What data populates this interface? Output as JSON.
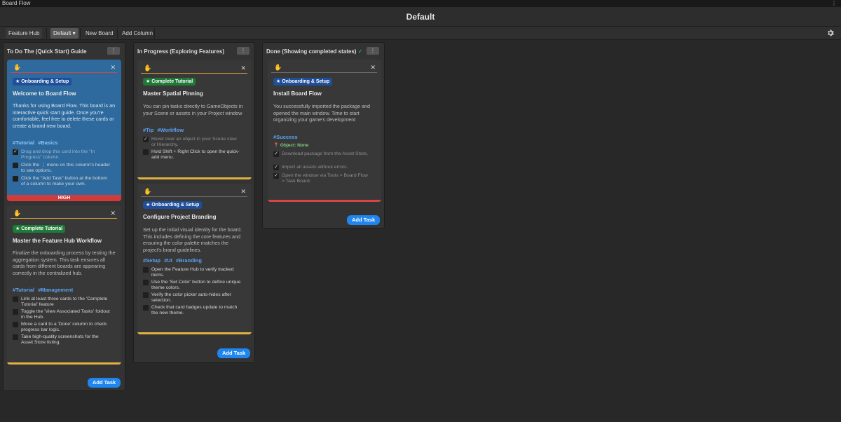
{
  "window": {
    "title": "Board Flow",
    "menu_icon": "more-vertical-icon"
  },
  "board": {
    "title": "Default"
  },
  "toolbar": {
    "feature_hub": "Feature Hub",
    "board_select": "Default ▾",
    "new_board": "New Board",
    "add_column": "Add Column",
    "settings_icon": "gear-icon"
  },
  "colors": {
    "accent": "#1f86f0",
    "high": "#d23b3b",
    "selected_card": "#2e6a9e",
    "tag": "#5aa3f0"
  },
  "columns": [
    {
      "title": "To Do The (Quick Start) Guide",
      "menu": "⋮",
      "add_task": "Add Task",
      "cards": [
        {
          "badge": "★ Onboarding & Setup",
          "title": "Welcome to Board Flow",
          "desc": "Thanks for using Board Flow. This board is an interactive quick start guide. Once you're comfortable, feel free to delete these cards or create a brand new board.",
          "tags": "#Tutorial #Basics",
          "tasks": [
            {
              "done": true,
              "text": "Drag and drop this card into the \"In Progress\" column."
            },
            {
              "done": false,
              "text": "Click the ⋮ menu on this column's header to see options."
            },
            {
              "done": false,
              "text": "Click the \"Add Task\" button at the bottom of a column to make your own."
            }
          ],
          "priority": "HIGH"
        },
        {
          "badge": "★ Complete Tutorial",
          "title": "Master the Feature Hub Workflow",
          "desc": "Finalize the onboarding process by testing the aggregation system. This task ensures all cards from different boards are appearing correctly in the centralized hub.",
          "tags": "#Tutorial #Management",
          "tasks": [
            {
              "done": false,
              "text": "Link at least three cards to the 'Complete Tutorial' feature"
            },
            {
              "done": false,
              "text": "Toggle the 'View Associated Tasks' foldout in the Hub."
            },
            {
              "done": false,
              "text": "Move a card to a 'Done' column to check progress bar logic."
            },
            {
              "done": false,
              "text": "Take high-quality screenshots for the Asset Store listing."
            }
          ]
        }
      ]
    },
    {
      "title": "In Progress (Exploring Features)",
      "menu": "⋮",
      "add_task": "Add Task",
      "cards": [
        {
          "badge": "★ Complete Tutorial",
          "title": "Master Spatial Pinning",
          "desc": "You can pin tasks directly to GameObjects in your Scene or assets in your Project window",
          "tags": "#Tip #Workflow",
          "tasks": [
            {
              "done": true,
              "text": "Hover over an object in your Scene view or Hierarchy."
            },
            {
              "done": false,
              "text": "Hold Shift + Right Click to open the quick-add menu."
            }
          ]
        },
        {
          "badge": "★ Onboarding & Setup",
          "title": "Configure Project Branding",
          "desc": "Set up the initial visual identity for the board. This includes defining the core features and ensuring the color palette matches the project's brand guidelines.",
          "tags": "#Setup #UI #Branding",
          "tasks": [
            {
              "done": false,
              "text": "Open the Feature Hub to verify tracked items."
            },
            {
              "done": false,
              "text": "Use the 'Set Color' button to define unique theme colors."
            },
            {
              "done": false,
              "text": "Verify the color picker auto-hides after selection."
            },
            {
              "done": false,
              "text": "Check that card badges update to match the new theme."
            }
          ]
        }
      ]
    },
    {
      "title": "Done (Showing completed states)",
      "title_check": "✓",
      "menu": "⋮",
      "add_task": "Add Task",
      "cards": [
        {
          "badge": "★ Onboarding & Setup",
          "title": "Install Board Flow",
          "desc": "You successfully imported the package and opened the main window. Time to start organizing your game's development",
          "tags": "#Success",
          "object": "Object: None",
          "tasks": [
            {
              "done": true,
              "text": "Download package from the Asset Store."
            },
            {
              "done": true,
              "text": "Import all assets without errors."
            },
            {
              "done": true,
              "text": "Open the window via Tools > Board Flow > Task Board."
            }
          ]
        }
      ]
    }
  ]
}
